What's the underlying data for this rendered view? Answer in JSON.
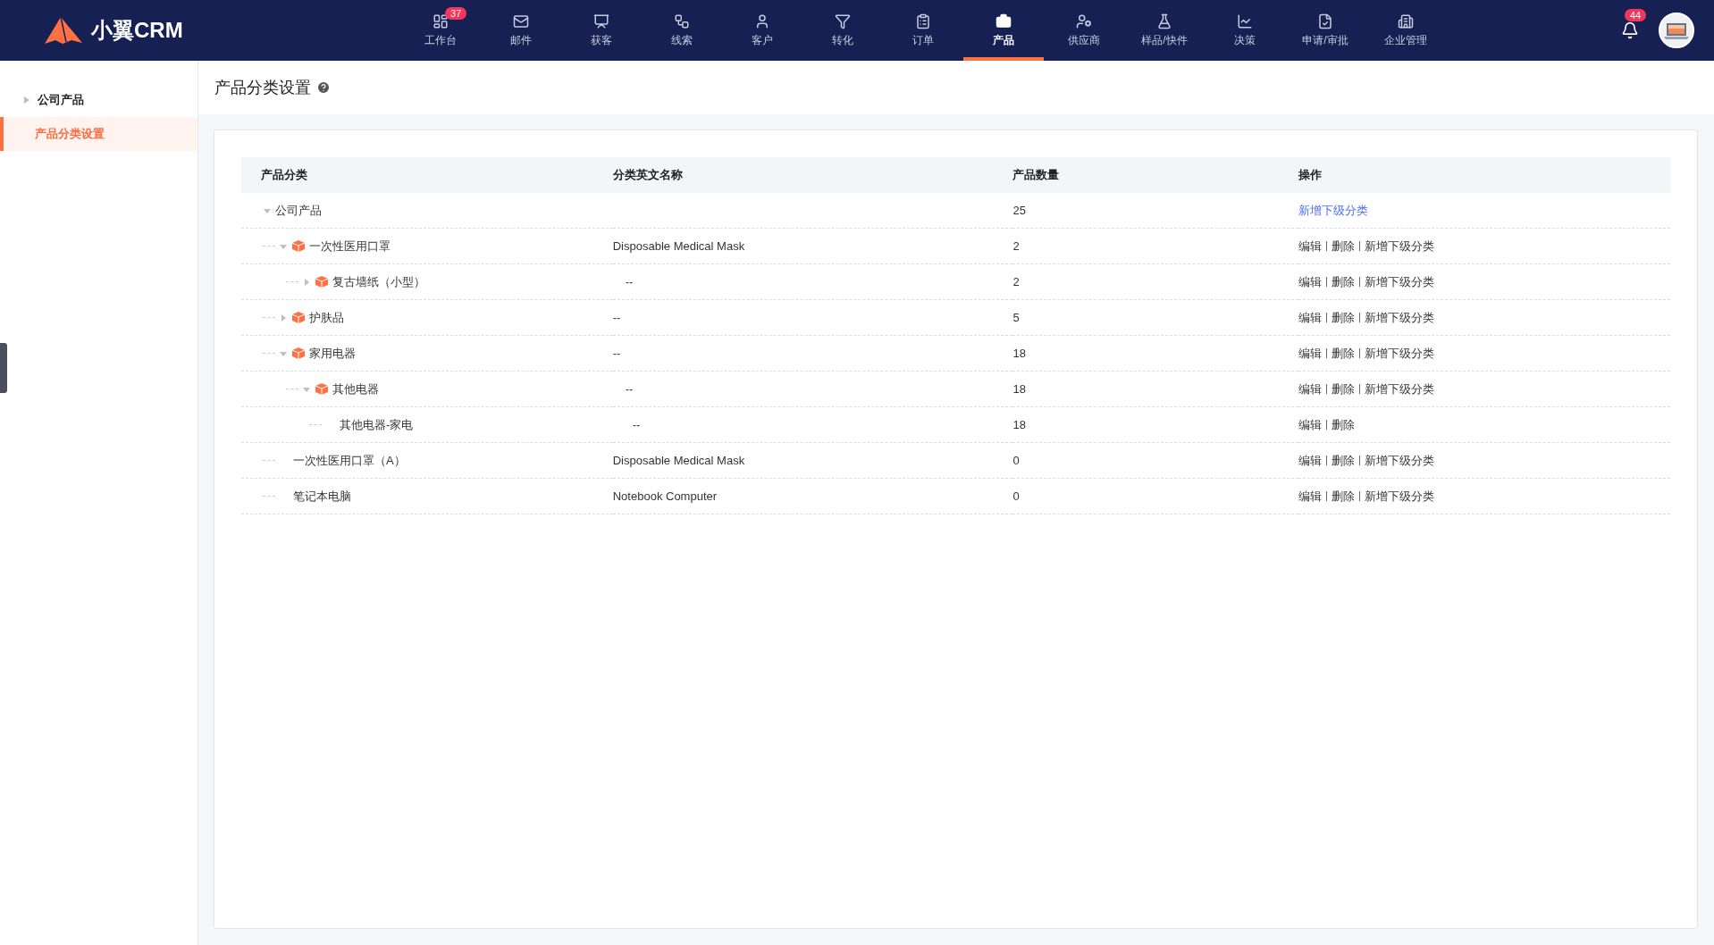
{
  "header": {
    "logo": "小翼CRM",
    "nav": [
      {
        "label": "工作台",
        "selected": false,
        "badge": "37"
      },
      {
        "label": "邮件",
        "selected": false
      },
      {
        "label": "获客",
        "selected": false
      },
      {
        "label": "线索",
        "selected": false
      },
      {
        "label": "客户",
        "selected": false
      },
      {
        "label": "转化",
        "selected": false
      },
      {
        "label": "订单",
        "selected": false
      },
      {
        "label": "产品",
        "selected": true
      },
      {
        "label": "供应商",
        "selected": false
      },
      {
        "label": "样品/快件",
        "selected": false
      },
      {
        "label": "决策",
        "selected": false
      },
      {
        "label": "申请/审批",
        "selected": false
      },
      {
        "label": "企业管理",
        "selected": false
      }
    ],
    "notifications_badge": "44"
  },
  "sidebar": {
    "items": [
      {
        "label": "公司产品",
        "selected": false,
        "kind": "group"
      },
      {
        "label": "产品分类设置",
        "selected": true,
        "kind": "item"
      }
    ]
  },
  "page": {
    "title": "产品分类设置"
  },
  "table": {
    "columns": [
      "产品分类",
      "分类英文名称",
      "产品数量",
      "操作"
    ],
    "rows": [
      {
        "name": "公司产品",
        "kind": "root",
        "expanded": true,
        "english": "",
        "count": "25",
        "actions": [
          "新增下级分类"
        ],
        "children": [
          {
            "name": "一次性医用口罩",
            "kind": "folder",
            "expanded": true,
            "english": "Disposable Medical Mask",
            "count": "2",
            "actions": [
              "编辑",
              "删除",
              "新增下级分类"
            ],
            "children": [
              {
                "name": "复古墙纸（小型）",
                "kind": "folder",
                "expanded": false,
                "english": "--",
                "count": "2",
                "actions": [
                  "编辑",
                  "删除",
                  "新增下级分类"
                ]
              }
            ]
          },
          {
            "name": "护肤品",
            "kind": "folder",
            "expanded": false,
            "english": "--",
            "count": "5",
            "actions": [
              "编辑",
              "删除",
              "新增下级分类"
            ]
          },
          {
            "name": "家用电器",
            "kind": "folder",
            "expanded": true,
            "english": "--",
            "count": "18",
            "actions": [
              "编辑",
              "删除",
              "新增下级分类"
            ],
            "children": [
              {
                "name": "其他电器",
                "kind": "folder",
                "expanded": true,
                "english": "--",
                "count": "18",
                "actions": [
                  "编辑",
                  "删除",
                  "新增下级分类"
                ],
                "children": [
                  {
                    "name": "其他电器-家电",
                    "kind": "leaf",
                    "english": "--",
                    "count": "18",
                    "actions": [
                      "编辑",
                      "删除"
                    ]
                  }
                ]
              }
            ]
          },
          {
            "name": "一次性医用口罩（A）",
            "kind": "leaf",
            "english": "Disposable Medical Mask",
            "count": "0",
            "actions": [
              "编辑",
              "删除",
              "新增下级分类"
            ]
          },
          {
            "name": "笔记本电脑",
            "kind": "leaf",
            "english": "Notebook Computer",
            "count": "0",
            "actions": [
              "编辑",
              "删除",
              "新增下级分类"
            ]
          }
        ]
      }
    ]
  }
}
